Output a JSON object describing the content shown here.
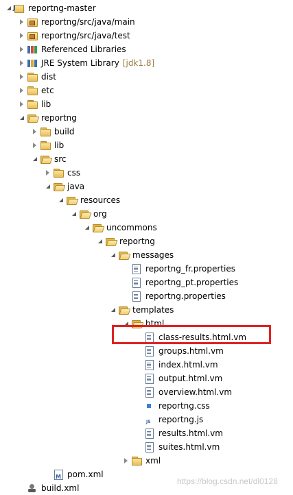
{
  "tree": [
    {
      "label": "reportng-master",
      "icon": "project",
      "toggle": "expanded",
      "depth": 0,
      "icon_name": "java-project-icon"
    },
    {
      "label": "reportng/src/java/main",
      "icon": "srcfolder",
      "toggle": "collapsed",
      "depth": 1,
      "icon_name": "source-folder-icon"
    },
    {
      "label": "reportng/src/java/test",
      "icon": "srcfolder",
      "toggle": "collapsed",
      "depth": 1,
      "icon_name": "source-folder-icon"
    },
    {
      "label": "Referenced Libraries",
      "icon": "lib",
      "toggle": "collapsed",
      "depth": 1,
      "icon_name": "library-icon"
    },
    {
      "label": "JRE System Library",
      "decoration": "[jdk1.8]",
      "icon": "jre",
      "toggle": "collapsed",
      "depth": 1,
      "icon_name": "jre-library-icon"
    },
    {
      "label": "dist",
      "icon": "folder",
      "toggle": "collapsed",
      "depth": 1,
      "icon_name": "folder-icon"
    },
    {
      "label": "etc",
      "icon": "folder",
      "toggle": "collapsed",
      "depth": 1,
      "icon_name": "folder-icon"
    },
    {
      "label": "lib",
      "icon": "folder",
      "toggle": "collapsed",
      "depth": 1,
      "icon_name": "folder-icon"
    },
    {
      "label": "reportng",
      "icon": "folder-open",
      "toggle": "expanded",
      "depth": 1,
      "icon_name": "open-folder-icon"
    },
    {
      "label": "build",
      "icon": "folder",
      "toggle": "collapsed",
      "depth": 2,
      "icon_name": "folder-icon"
    },
    {
      "label": "lib",
      "icon": "folder",
      "toggle": "collapsed",
      "depth": 2,
      "icon_name": "folder-icon"
    },
    {
      "label": "src",
      "icon": "folder-open",
      "toggle": "expanded",
      "depth": 2,
      "icon_name": "open-folder-icon"
    },
    {
      "label": "css",
      "icon": "folder",
      "toggle": "collapsed",
      "depth": 3,
      "icon_name": "folder-icon"
    },
    {
      "label": "java",
      "icon": "folder-open",
      "toggle": "expanded",
      "depth": 3,
      "icon_name": "open-folder-icon"
    },
    {
      "label": "resources",
      "icon": "folder-open",
      "toggle": "expanded",
      "depth": 4,
      "icon_name": "open-folder-icon"
    },
    {
      "label": "org",
      "icon": "folder-open",
      "toggle": "expanded",
      "depth": 5,
      "icon_name": "open-folder-icon"
    },
    {
      "label": "uncommons",
      "icon": "folder-open",
      "toggle": "expanded",
      "depth": 6,
      "icon_name": "open-folder-icon"
    },
    {
      "label": "reportng",
      "icon": "folder-open",
      "toggle": "expanded",
      "depth": 7,
      "icon_name": "open-folder-icon"
    },
    {
      "label": "messages",
      "icon": "folder-open",
      "toggle": "expanded",
      "depth": 8,
      "icon_name": "open-folder-icon"
    },
    {
      "label": "reportng_fr.properties",
      "icon": "file",
      "toggle": "none",
      "depth": 9,
      "icon_name": "properties-file-icon"
    },
    {
      "label": "reportng_pt.properties",
      "icon": "file",
      "toggle": "none",
      "depth": 9,
      "icon_name": "properties-file-icon"
    },
    {
      "label": "reportng.properties",
      "icon": "file",
      "toggle": "none",
      "depth": 9,
      "icon_name": "properties-file-icon"
    },
    {
      "label": "templates",
      "icon": "folder-open",
      "toggle": "expanded",
      "depth": 8,
      "icon_name": "open-folder-icon"
    },
    {
      "label": "html",
      "icon": "folder-open",
      "toggle": "expanded",
      "depth": 9,
      "icon_name": "open-folder-icon"
    },
    {
      "label": "class-results.html.vm",
      "icon": "file",
      "toggle": "none",
      "depth": 10,
      "icon_name": "file-icon"
    },
    {
      "label": "groups.html.vm",
      "icon": "file",
      "toggle": "none",
      "depth": 10,
      "icon_name": "file-icon"
    },
    {
      "label": "index.html.vm",
      "icon": "file",
      "toggle": "none",
      "depth": 10,
      "icon_name": "file-icon"
    },
    {
      "label": "output.html.vm",
      "icon": "file",
      "toggle": "none",
      "depth": 10,
      "icon_name": "file-icon"
    },
    {
      "label": "overview.html.vm",
      "icon": "file",
      "toggle": "none",
      "depth": 10,
      "icon_name": "file-icon"
    },
    {
      "label": "reportng.css",
      "icon": "css",
      "toggle": "none",
      "depth": 10,
      "icon_name": "css-file-icon"
    },
    {
      "label": "reportng.js",
      "icon": "js",
      "toggle": "none",
      "depth": 10,
      "icon_name": "js-file-icon"
    },
    {
      "label": "results.html.vm",
      "icon": "file",
      "toggle": "none",
      "depth": 10,
      "icon_name": "file-icon"
    },
    {
      "label": "suites.html.vm",
      "icon": "file",
      "toggle": "none",
      "depth": 10,
      "icon_name": "file-icon"
    },
    {
      "label": "xml",
      "icon": "folder",
      "toggle": "collapsed",
      "depth": 9,
      "icon_name": "folder-icon"
    },
    {
      "label": "pom.xml",
      "icon": "xml",
      "toggle": "none",
      "depth": 3,
      "icon_name": "maven-pom-icon"
    },
    {
      "label": "build.xml",
      "icon": "ant",
      "toggle": "none",
      "depth": 1,
      "icon_name": "ant-build-icon"
    }
  ],
  "highlighted_item": "class-results.html.vm",
  "highlight_color": "#e02222",
  "watermark": "https://blog.csdn.net/dl0128"
}
